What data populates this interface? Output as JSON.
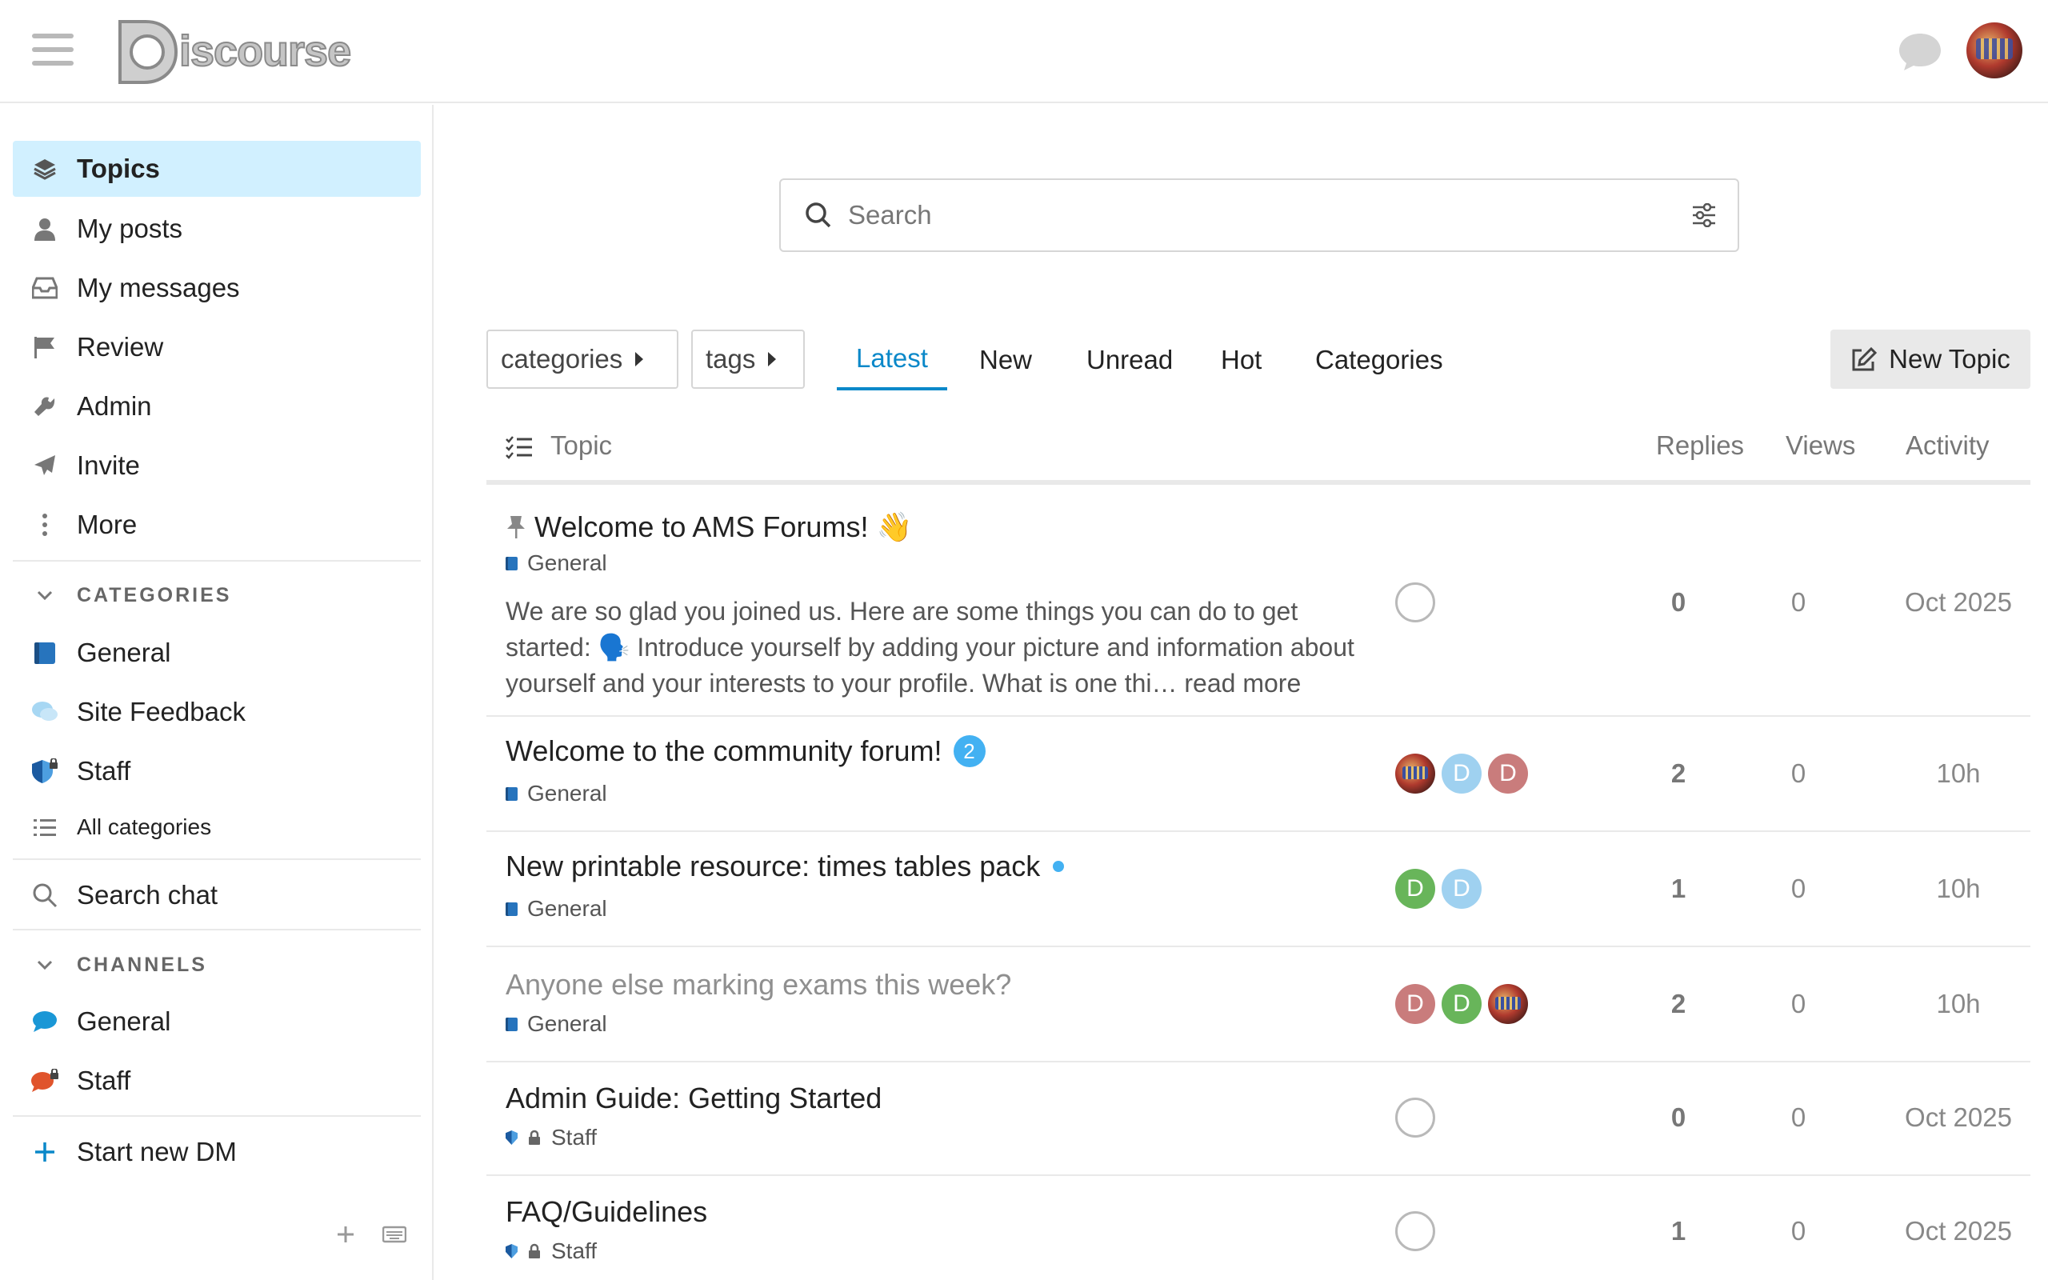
{
  "header": {
    "logo_text": "iscourse",
    "logo_alt": "Discourse"
  },
  "sidebar": {
    "items": [
      {
        "label": "Topics",
        "icon": "layers-icon"
      },
      {
        "label": "My posts",
        "icon": "user-icon"
      },
      {
        "label": "My messages",
        "icon": "inbox-icon"
      },
      {
        "label": "Review",
        "icon": "flag-icon"
      },
      {
        "label": "Admin",
        "icon": "wrench-icon"
      },
      {
        "label": "Invite",
        "icon": "paper-plane-icon"
      },
      {
        "label": "More",
        "icon": "ellipsis-vertical-icon"
      }
    ],
    "categories_heading": "CATEGORIES",
    "categories": [
      {
        "label": "General",
        "color": "#2774bd"
      },
      {
        "label": "Site Feedback",
        "color": "#a7d7f3"
      },
      {
        "label": "Staff",
        "color": "#2774bd"
      }
    ],
    "all_categories": "All categories",
    "search_chat": "Search chat",
    "channels_heading": "CHANNELS",
    "channels": [
      {
        "label": "General",
        "color": "#1a97d6"
      },
      {
        "label": "Staff",
        "color": "#e0542c"
      }
    ],
    "start_dm": "Start new DM"
  },
  "search": {
    "placeholder": "Search"
  },
  "nav": {
    "categories_dropdown": "categories",
    "tags_dropdown": "tags",
    "tabs": [
      "Latest",
      "New",
      "Unread",
      "Hot",
      "Categories"
    ],
    "new_topic": "New Topic"
  },
  "table": {
    "headers": {
      "topic": "Topic",
      "replies": "Replies",
      "views": "Views",
      "activity": "Activity"
    },
    "rows": [
      {
        "title": "Welcome to AMS Forums! 👋",
        "category": "General",
        "excerpt": "We are so glad you joined us. Here are some things you can do to get started: 🗣️ Introduce yourself by adding your picture and information about yourself and your interests to your profile. What is one thi…",
        "read_more": "read more",
        "replies": "0",
        "views": "0",
        "activity": "Oct 2025"
      },
      {
        "title": "Welcome to the community forum!",
        "unread_count": "2",
        "category": "General",
        "replies": "2",
        "views": "0",
        "activity": "10h"
      },
      {
        "title": "New printable resource: times tables pack",
        "category": "General",
        "replies": "1",
        "views": "0",
        "activity": "10h"
      },
      {
        "title": "Anyone else marking exams this week?",
        "category": "General",
        "replies": "2",
        "views": "0",
        "activity": "10h"
      },
      {
        "title": "Admin Guide: Getting Started",
        "category": "Staff",
        "replies": "0",
        "views": "0",
        "activity": "Oct 2025"
      },
      {
        "title": "FAQ/Guidelines",
        "category": "Staff",
        "replies": "1",
        "views": "0",
        "activity": "Oct 2025"
      }
    ]
  },
  "avatar_letter": "D"
}
